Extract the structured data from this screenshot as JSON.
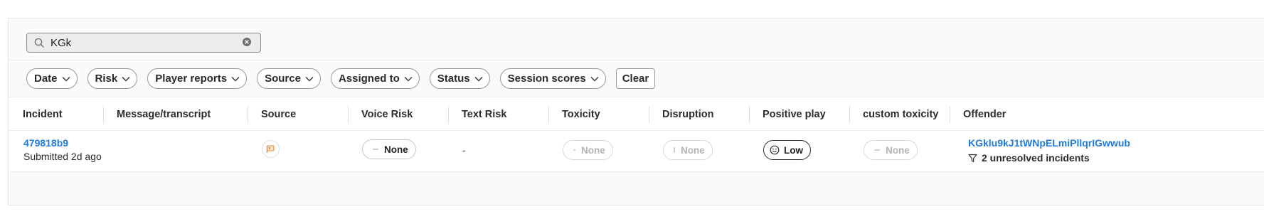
{
  "search": {
    "value": "KGk",
    "placeholder": ""
  },
  "filters": [
    "Date",
    "Risk",
    "Player reports",
    "Source",
    "Assigned to",
    "Status",
    "Session scores"
  ],
  "clear_label": "Clear",
  "columns": [
    "Incident",
    "Message/transcript",
    "Source",
    "Voice Risk",
    "Text Risk",
    "Toxicity",
    "Disruption",
    "Positive play",
    "custom toxicity",
    "Offender"
  ],
  "rows": [
    {
      "incident_id": "479818b9",
      "submitted": "Submitted 2d ago",
      "message": "",
      "source_icon": "flag-icon",
      "voice_risk": "None",
      "text_risk": "-",
      "toxicity": "None",
      "disruption": "None",
      "positive_play": "Low",
      "custom_toxicity": "None",
      "offender_id": "KGklu9kJ1tWNpELmiPllqrIGwwub",
      "offender_note": "2 unresolved incidents"
    }
  ],
  "colors": {
    "link": "#1f7ad8",
    "muted": "#b4b4b4",
    "source_icon": "#e8893a"
  }
}
